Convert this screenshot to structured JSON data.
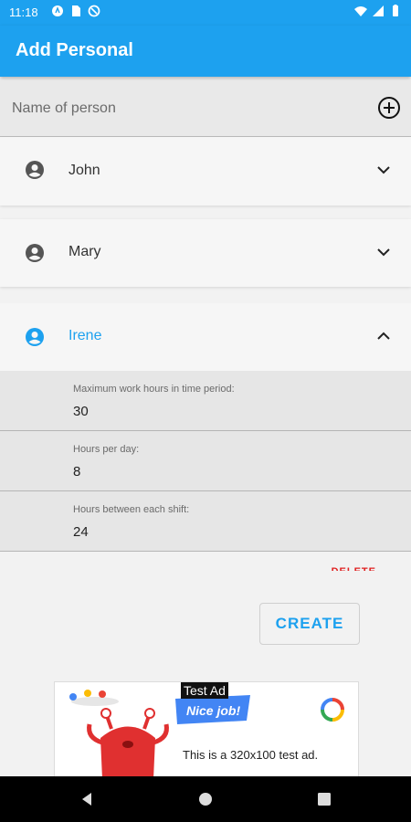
{
  "status_bar": {
    "time": "11:18",
    "icons": [
      "android-icon",
      "sim-icon",
      "data-saver-icon"
    ],
    "right_icons": [
      "wifi-icon",
      "signal-icon",
      "battery-icon"
    ]
  },
  "app_bar": {
    "title": "Add Personal",
    "color": "#1da1ef"
  },
  "name_input": {
    "placeholder": "Name of person",
    "value": ""
  },
  "people": [
    {
      "name": "John",
      "expanded": false
    },
    {
      "name": "Mary",
      "expanded": false
    },
    {
      "name": "Irene",
      "expanded": true
    }
  ],
  "fields": [
    {
      "label": "Maximum work hours in time period:",
      "value": "30"
    },
    {
      "label": "Hours per day:",
      "value": "8"
    },
    {
      "label": "Hours between each shift:",
      "value": "24"
    }
  ],
  "actions": {
    "delete_label": "DELETE",
    "create_label": "CREATE"
  },
  "ad": {
    "badge": "Test Ad",
    "banner_text": "Nice job!",
    "description": "This is a 320x100 test ad."
  },
  "colors": {
    "accent": "#1da1ef",
    "danger": "#e02020"
  }
}
